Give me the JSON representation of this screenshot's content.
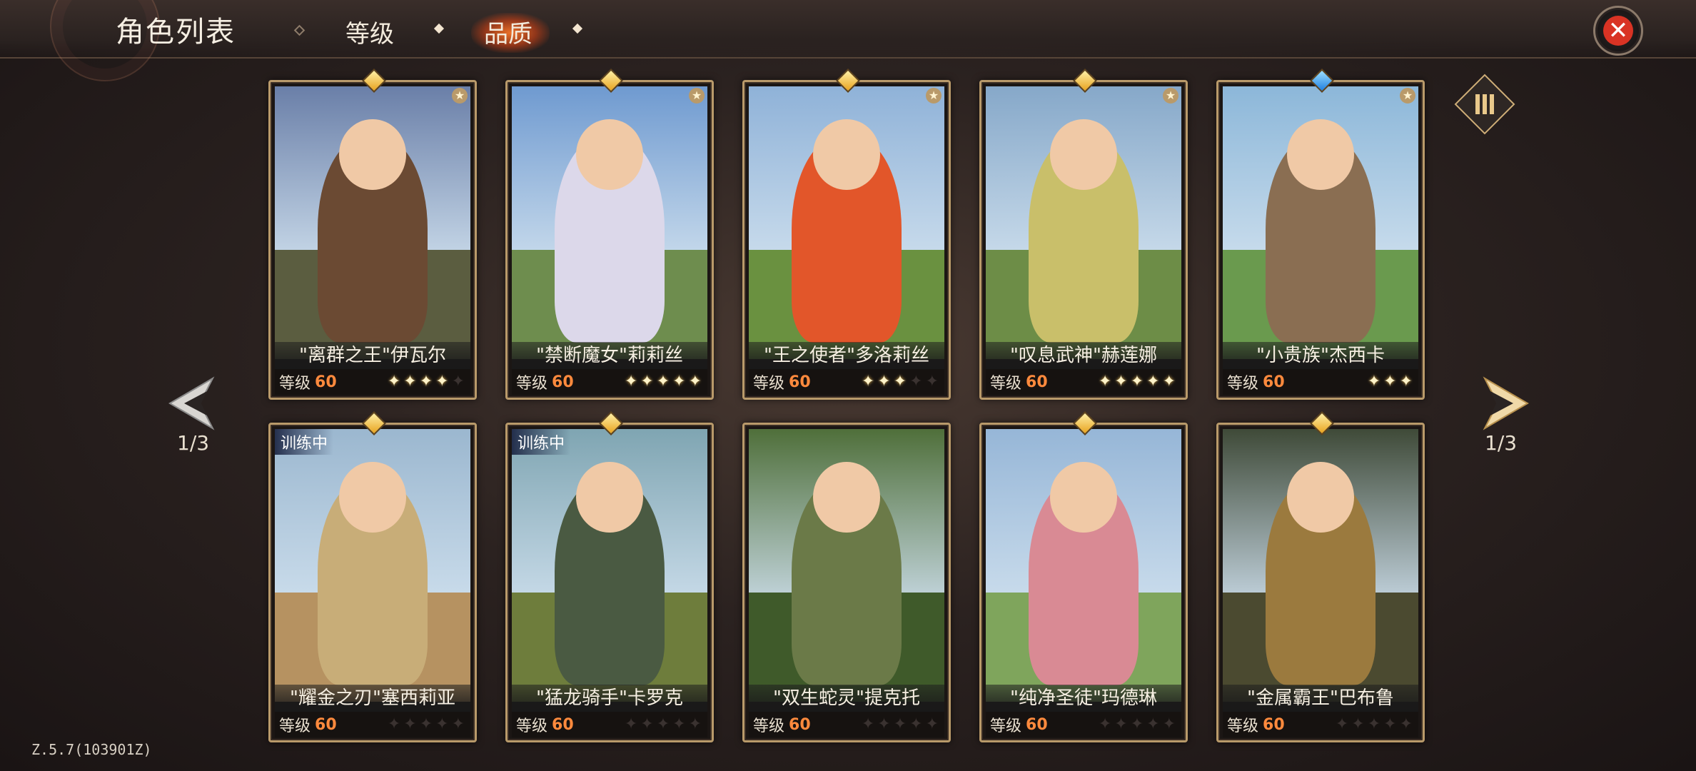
{
  "header": {
    "title": "角色列表",
    "tabs": [
      {
        "label": "等级",
        "active": false
      },
      {
        "label": "品质",
        "active": true
      }
    ],
    "close_icon": "close-icon"
  },
  "pagination": {
    "left": "1/3",
    "right": "1/3"
  },
  "level_label": "等级",
  "cards": [
    {
      "name": "\"离群之王\"伊瓦尔",
      "level": "60",
      "stars": 4,
      "max_stars": 5,
      "gem": "gold",
      "badge": true,
      "training": "",
      "colors": {
        "sky": "#6a7fa8",
        "ground": "#5b5d40",
        "figure": "#6b4a33"
      }
    },
    {
      "name": "\"禁断魔女\"莉莉丝",
      "level": "60",
      "stars": 5,
      "max_stars": 5,
      "gem": "gold",
      "badge": true,
      "training": "",
      "colors": {
        "sky": "#6f9ad0",
        "ground": "#6e8d4e",
        "figure": "#dcd8ea"
      }
    },
    {
      "name": "\"王之使者\"多洛莉丝",
      "level": "60",
      "stars": 3,
      "max_stars": 5,
      "gem": "gold",
      "badge": true,
      "training": "",
      "colors": {
        "sky": "#8fb2d8",
        "ground": "#6a9140",
        "figure": "#e2562a"
      }
    },
    {
      "name": "\"叹息武神\"赫莲娜",
      "level": "60",
      "stars": 5,
      "max_stars": 5,
      "gem": "gold",
      "badge": true,
      "training": "",
      "colors": {
        "sky": "#86a8c9",
        "ground": "#6d8d47",
        "figure": "#c9bf6a"
      }
    },
    {
      "name": "\"小贵族\"杰西卡",
      "level": "60",
      "stars": 3,
      "max_stars": 3,
      "gem": "blue",
      "badge": true,
      "training": "",
      "colors": {
        "sky": "#8cb7d9",
        "ground": "#6a9a4e",
        "figure": "#8a6e52"
      }
    },
    {
      "name": "\"耀金之刃\"塞西莉亚",
      "level": "60",
      "stars": 0,
      "max_stars": 5,
      "gem": "gold",
      "badge": false,
      "training": "训练中",
      "colors": {
        "sky": "#9bb7cf",
        "ground": "#b69261",
        "figure": "#c8ad78"
      }
    },
    {
      "name": "\"猛龙骑手\"卡罗克",
      "level": "60",
      "stars": 0,
      "max_stars": 5,
      "gem": "gold",
      "badge": false,
      "training": "训练中",
      "colors": {
        "sky": "#7fa5b2",
        "ground": "#6e7d3c",
        "figure": "#4a5a42"
      }
    },
    {
      "name": "\"双生蛇灵\"提克托",
      "level": "60",
      "stars": 0,
      "max_stars": 5,
      "gem": "",
      "badge": false,
      "training": "",
      "colors": {
        "sky": "#4f6f3a",
        "ground": "#3f5a2a",
        "figure": "#6b7a48"
      }
    },
    {
      "name": "\"纯净圣徒\"玛德琳",
      "level": "60",
      "stars": 0,
      "max_stars": 5,
      "gem": "gold",
      "badge": false,
      "training": "",
      "colors": {
        "sky": "#96b6d7",
        "ground": "#7fa55c",
        "figure": "#d98a94"
      }
    },
    {
      "name": "\"金属霸王\"巴布鲁",
      "level": "60",
      "stars": 0,
      "max_stars": 5,
      "gem": "gold",
      "badge": false,
      "training": "",
      "colors": {
        "sky": "#3f4a38",
        "ground": "#4b4a30",
        "figure": "#9b7a3e"
      }
    }
  ],
  "version": "Z.5.7(103901Z)",
  "icons": {
    "prev": "arrow-left-icon",
    "next": "arrow-right-icon",
    "sort": "sort-icon"
  }
}
